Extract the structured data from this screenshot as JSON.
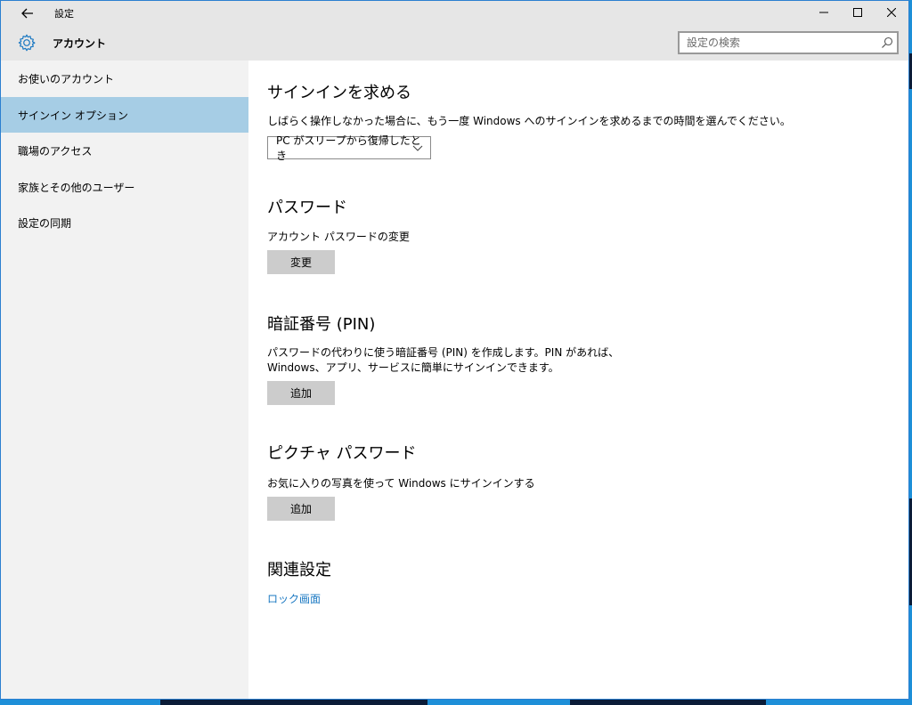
{
  "window": {
    "title": "設定",
    "app_name": "アカウント",
    "search_placeholder": "設定の検索",
    "controls": [
      "minimize-icon",
      "maximize-icon",
      "close-icon"
    ]
  },
  "sidebar": {
    "items": [
      {
        "label": "お使いのアカウント",
        "active": false
      },
      {
        "label": "サインイン オプション",
        "active": true
      },
      {
        "label": "職場のアクセス",
        "active": false
      },
      {
        "label": "家族とその他のユーザー",
        "active": false
      },
      {
        "label": "設定の同期",
        "active": false
      }
    ]
  },
  "main": {
    "require_signin": {
      "heading": "サインインを求める",
      "description": "しばらく操作しなかった場合に、もう一度 Windows へのサインインを求めるまでの時間を選んでください。",
      "dropdown_value": "PC がスリープから復帰したとき"
    },
    "password": {
      "heading": "パスワード",
      "description": "アカウント パスワードの変更",
      "button": "変更"
    },
    "pin": {
      "heading": "暗証番号 (PIN)",
      "description_line1": "パスワードの代わりに使う暗証番号 (PIN) を作成します。PIN があれば、",
      "description_line2": "Windows、アプリ、サービスに簡単にサインインできます。",
      "button": "追加"
    },
    "picture_password": {
      "heading": "ピクチャ パスワード",
      "description": "お気に入りの写真を使って Windows にサインインする",
      "button": "追加"
    },
    "related": {
      "heading": "関連設定",
      "link": "ロック画面"
    }
  },
  "colors": {
    "accent": "#1a78c2",
    "nav_active": "#a6cde5",
    "button_bg": "#cccccc",
    "titlebar_bg": "#e6e6e6",
    "sidebar_bg": "#f2f2f2"
  }
}
